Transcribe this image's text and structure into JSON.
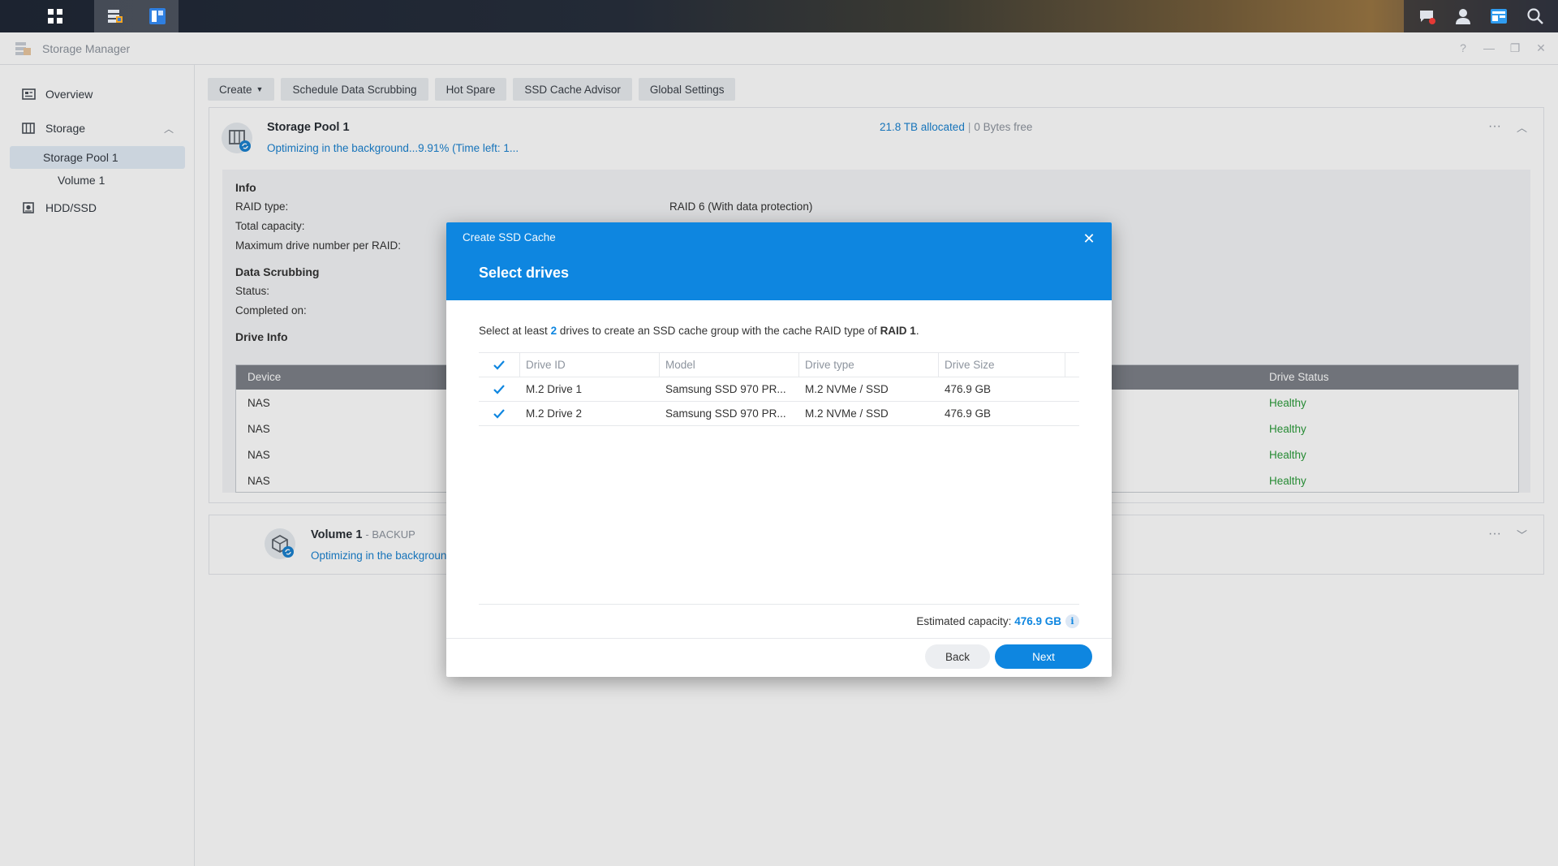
{
  "window": {
    "title": "Storage Manager"
  },
  "sidebar": {
    "items": [
      {
        "label": "Overview"
      },
      {
        "label": "Storage"
      },
      {
        "label": "Storage Pool 1"
      },
      {
        "label": "Volume 1"
      },
      {
        "label": "HDD/SSD"
      }
    ]
  },
  "toolbar": {
    "create": "Create",
    "schedule": "Schedule Data Scrubbing",
    "hot_spare": "Hot Spare",
    "ssd_advisor": "SSD Cache Advisor",
    "global_settings": "Global Settings"
  },
  "pool": {
    "name": "Storage Pool 1",
    "status": "Optimizing in the background...9.91% (Time left: 1...",
    "allocated": "21.8 TB allocated",
    "separator": "|",
    "free": "0 Bytes free",
    "info_title": "Info",
    "raid_type_label": "RAID type:",
    "raid_type_value": "RAID 6 (With data protection)",
    "total_capacity_label": "Total capacity:",
    "max_drive_label": "Maximum drive number per RAID:",
    "scrub_title": "Data Scrubbing",
    "status_label": "Status:",
    "completed_label": "Completed on:",
    "drive_info_title": "Drive Info",
    "drive_table": {
      "headers": {
        "device": "Device",
        "status": "Drive Status"
      },
      "rows": [
        {
          "device": "NAS",
          "status": "Healthy"
        },
        {
          "device": "NAS",
          "status": "Healthy"
        },
        {
          "device": "NAS",
          "status": "Healthy"
        },
        {
          "device": "NAS",
          "status": "Healthy"
        }
      ]
    }
  },
  "volume": {
    "name": "Volume 1",
    "tag": "- BACKUP",
    "status": "Optimizing in the background"
  },
  "dialog": {
    "subtitle": "Create SSD Cache",
    "title": "Select drives",
    "desc_before": "Select at least",
    "desc_count": "2",
    "desc_middle": "drives to create an SSD cache group with the cache RAID type of",
    "desc_raid": "RAID 1",
    "desc_end": ".",
    "table": {
      "headers": {
        "drive_id": "Drive ID",
        "model": "Model",
        "drive_type": "Drive type",
        "drive_size": "Drive Size"
      },
      "rows": [
        {
          "drive_id": "M.2 Drive 1",
          "model": "Samsung SSD 970 PR...",
          "drive_type": "M.2 NVMe / SSD",
          "drive_size": "476.9 GB",
          "checked": true
        },
        {
          "drive_id": "M.2 Drive 2",
          "model": "Samsung SSD 970 PR...",
          "drive_type": "M.2 NVMe / SSD",
          "drive_size": "476.9 GB",
          "checked": true
        }
      ]
    },
    "estimated_label": "Estimated capacity:",
    "estimated_value": "476.9 GB",
    "back": "Back",
    "next": "Next"
  },
  "colors": {
    "accent": "#0e86e0",
    "healthy": "#2b9b3a",
    "table_header": "#7d8188"
  }
}
